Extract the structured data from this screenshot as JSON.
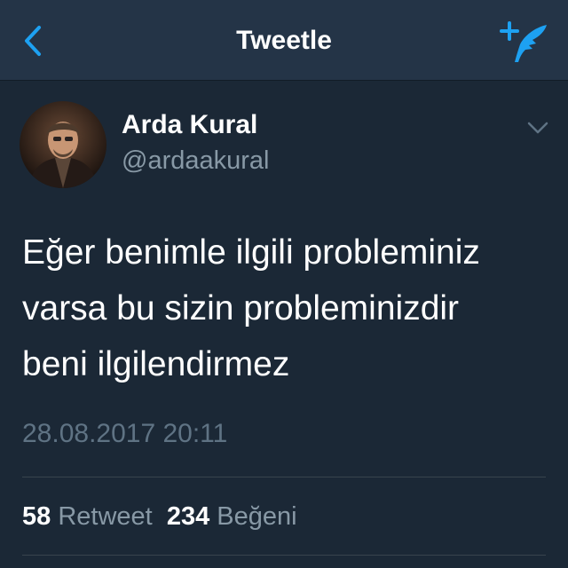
{
  "header": {
    "title": "Tweetle",
    "back_icon": "chevron-left-icon",
    "compose_icon": "compose-tweet-icon"
  },
  "tweet": {
    "author": {
      "name": "Arda Kural",
      "handle": "@ardaakural",
      "avatar_icon": "profile-photo"
    },
    "text_lines": [
      "Eğer benimle ilgili probleminiz",
      "varsa bu sizin probleminizdir",
      "beni ilgilendirmez"
    ],
    "timestamp": "28.08.2017 20:11",
    "stats": {
      "retweet_count": "58",
      "retweet_label": "Retweet",
      "like_count": "234",
      "like_label": "Beğeni"
    }
  },
  "colors": {
    "background": "#1b2836",
    "navbar": "#243447",
    "accent": "#1da1f2",
    "secondary_text": "#8899a6"
  }
}
